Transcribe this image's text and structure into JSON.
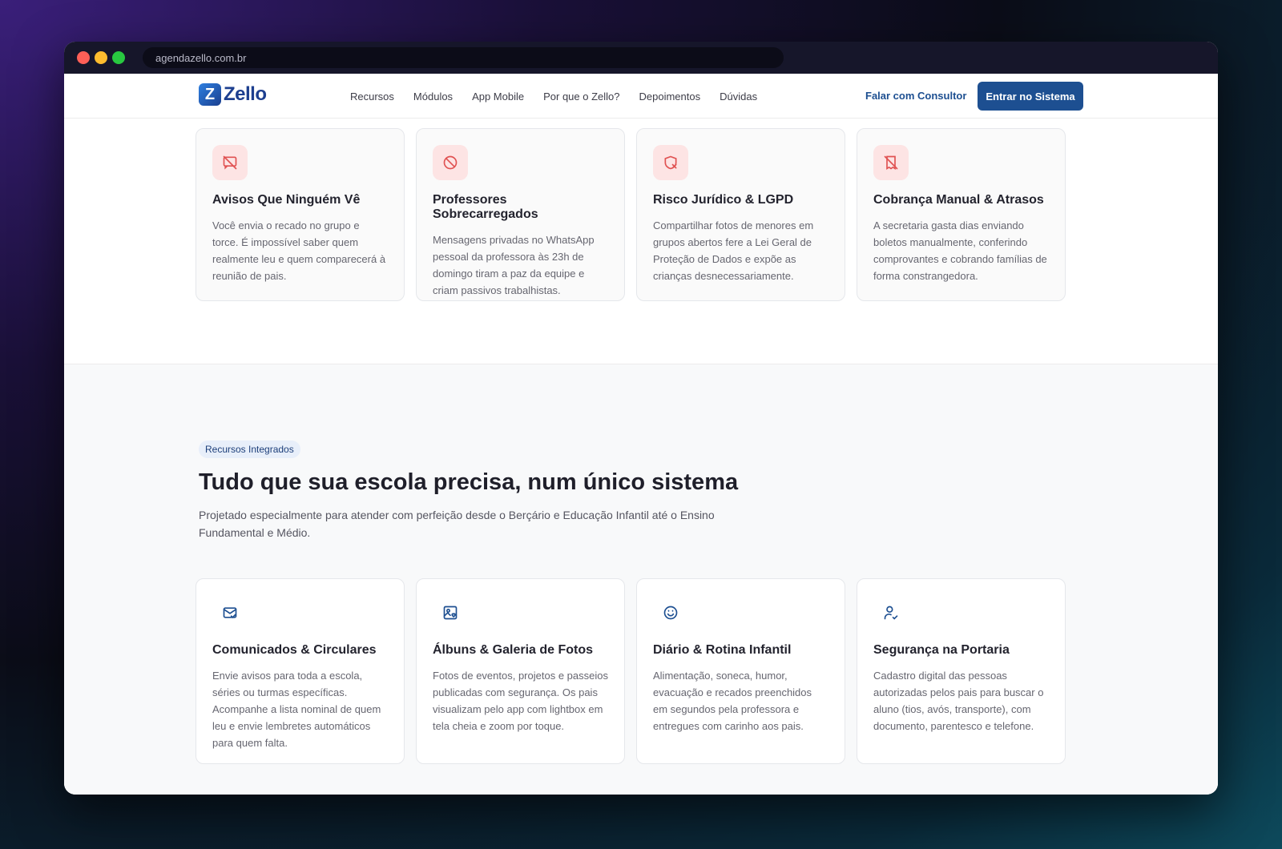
{
  "browser": {
    "url": "agendazello.com.br"
  },
  "brand": {
    "logo_mark": "Z",
    "logo_text": "Zello"
  },
  "nav": {
    "links": [
      "Recursos",
      "Módulos",
      "App Mobile",
      "Por que o Zello?",
      "Depoimentos",
      "Dúvidas"
    ],
    "consult_label": "Falar com Consultor",
    "enter_label": "Entrar no Sistema"
  },
  "problems": [
    {
      "icon": "message-off-icon",
      "title": "Avisos Que Ninguém Vê",
      "text": "Você envia o recado no grupo e torce. É impossível saber quem realmente leu e quem comparecerá à reunião de pais."
    },
    {
      "icon": "block-icon",
      "title": "Professores Sobrecarregados",
      "text": "Mensagens privadas no WhatsApp pessoal da professora às 23h de domingo tiram a paz da equipe e criam passivos trabalhistas."
    },
    {
      "icon": "shield-x-icon",
      "title": "Risco Jurídico & LGPD",
      "text": "Compartilhar fotos de menores em grupos abertos fere a Lei Geral de Proteção de Dados e expõe as crianças desnecessariamente."
    },
    {
      "icon": "receipt-off-icon",
      "title": "Cobrança Manual & Atrasos",
      "text": "A secretaria gasta dias enviando boletos manualmente, conferindo comprovantes e cobrando famílias de forma constrangedora."
    }
  ],
  "features_section": {
    "badge": "Recursos Integrados",
    "title": "Tudo que sua escola precisa, num único sistema",
    "subtitle": "Projetado especialmente para atender com perfeição desde o Berçário e Educação Infantil até o Ensino Fundamental e Médio."
  },
  "features": [
    {
      "icon": "mail-check-icon",
      "title": "Comunicados & Circulares",
      "text": "Envie avisos para toda a escola, séries ou turmas específicas. Acompanhe a lista nominal de quem leu e envie lembretes automáticos para quem falta."
    },
    {
      "icon": "image-heart-icon",
      "title": "Álbuns & Galeria de Fotos",
      "text": "Fotos de eventos, projetos e passeios publicadas com segurança. Os pais visualizam pelo app com lightbox em tela cheia e zoom por toque."
    },
    {
      "icon": "smile-icon",
      "title": "Diário & Rotina Infantil",
      "text": "Alimentação, soneca, humor, evacuação e recados preenchidos em segundos pela professora e entregues com carinho aos pais."
    },
    {
      "icon": "user-check-icon",
      "title": "Segurança na Portaria",
      "text": "Cadastro digital das pessoas autorizadas pelos pais para buscar o aluno (tios, avós, transporte), com documento, parentesco e telefone."
    }
  ],
  "colors": {
    "accent": "#1d4f91",
    "danger": "#e05252",
    "danger_bg": "#fde4e4"
  }
}
